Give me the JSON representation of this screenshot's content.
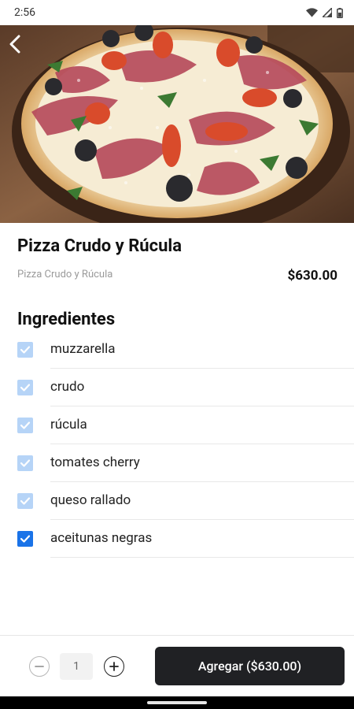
{
  "status_bar": {
    "time": "2:56"
  },
  "product": {
    "title": "Pizza Crudo y Rúcula",
    "subtitle": "Pizza Crudo y Rúcula",
    "price": "$630.00"
  },
  "ingredients": {
    "title": "Ingredientes",
    "items": [
      {
        "label": "muzzarella",
        "checked": true,
        "style": "light"
      },
      {
        "label": "crudo",
        "checked": true,
        "style": "light"
      },
      {
        "label": "rúcula",
        "checked": true,
        "style": "light"
      },
      {
        "label": "tomates cherry",
        "checked": true,
        "style": "light"
      },
      {
        "label": "queso rallado",
        "checked": true,
        "style": "light"
      },
      {
        "label": "aceitunas negras",
        "checked": true,
        "style": "dark"
      }
    ]
  },
  "cart": {
    "quantity": "1",
    "add_button_label": "Agregar ($630.00)"
  },
  "colors": {
    "check_light": "#b6d4f7",
    "check_dark": "#1a73e8",
    "add_button_bg": "#202124"
  }
}
